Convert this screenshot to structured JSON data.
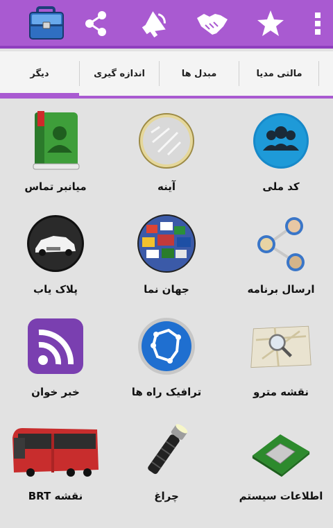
{
  "tabs": [
    {
      "label": "مالتی مدیا"
    },
    {
      "label": "مبدل ها"
    },
    {
      "label": "اندازه گیری"
    },
    {
      "label": "دیگر"
    }
  ],
  "active_tab": "دیگر",
  "action_bar": {
    "icons": [
      "toolbox-icon",
      "share-icon",
      "megaphone-icon",
      "handshake-icon",
      "star-icon",
      "overflow-menu-icon"
    ],
    "accent_color": "#a95ad1"
  },
  "grid": [
    {
      "label": "میانبر تماس",
      "icon": "contact-book-icon"
    },
    {
      "label": "آینه",
      "icon": "mirror-icon"
    },
    {
      "label": "کد ملی",
      "icon": "group-icon"
    },
    {
      "label": "پلاک یاب",
      "icon": "car-icon"
    },
    {
      "label": "جهان نما",
      "icon": "globe-flags-icon"
    },
    {
      "label": "ارسال برنامه",
      "icon": "share-network-icon"
    },
    {
      "label": "خبر خوان",
      "icon": "rss-icon"
    },
    {
      "label": "ترافیک راه ها",
      "icon": "traffic-map-icon"
    },
    {
      "label": "نقشه مترو",
      "icon": "map-search-icon"
    },
    {
      "label": "نقشه BRT",
      "icon": "bus-icon"
    },
    {
      "label": "چراغ",
      "icon": "flashlight-icon"
    },
    {
      "label": "اطلاعات سیستم",
      "icon": "chip-icon"
    }
  ]
}
